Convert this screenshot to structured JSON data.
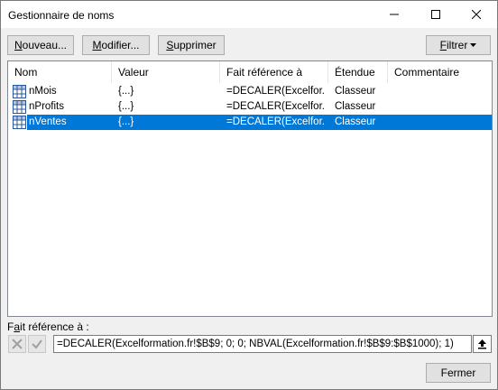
{
  "window": {
    "title": "Gestionnaire de noms"
  },
  "toolbar": {
    "new_label": "Nouveau...",
    "new_mnemonic": "N",
    "new_rest": "ouveau...",
    "edit_label": "Modifier...",
    "edit_mnemonic": "M",
    "edit_rest": "odifier...",
    "delete_label": "Supprimer",
    "delete_mnemonic": "S",
    "delete_rest": "upprimer",
    "filter_label": "Filtrer",
    "filter_mnemonic": "F",
    "filter_rest": "iltrer"
  },
  "table": {
    "columns": {
      "name": "Nom",
      "value": "Valeur",
      "refers_to": "Fait référence à",
      "scope": "Étendue",
      "comment": "Commentaire"
    },
    "rows": [
      {
        "name": "nMois",
        "value": "{...}",
        "refers_to": "=DECALER(Excelfor...",
        "scope": "Classeur",
        "comment": "",
        "selected": false
      },
      {
        "name": "nProfits",
        "value": "{...}",
        "refers_to": "=DECALER(Excelfor...",
        "scope": "Classeur",
        "comment": "",
        "selected": false
      },
      {
        "name": "nVentes",
        "value": "{...}",
        "refers_to": "=DECALER(Excelfor...",
        "scope": "Classeur",
        "comment": "",
        "selected": true
      }
    ]
  },
  "reference": {
    "label_mnemonic": "a",
    "label_pre": "F",
    "label_rest": "it référence à :",
    "formula": "=DECALER(Excelformation.fr!$B$9; 0; 0; NBVAL(Excelformation.fr!$B$9:$B$1000); 1)"
  },
  "footer": {
    "close_label": "Fermer"
  },
  "colors": {
    "selection": "#0078d7",
    "dialog_bg": "#f0f0f0",
    "button_bg": "#e1e1e1"
  },
  "icons": {
    "minimize": "minimize-icon",
    "maximize": "maximize-icon",
    "close": "close-icon",
    "named-range": "grid-icon",
    "cancel": "cancel-x-icon",
    "confirm": "checkmark-icon",
    "collapse": "collapse-dialog-icon",
    "dropdown": "dropdown-arrow-icon"
  }
}
